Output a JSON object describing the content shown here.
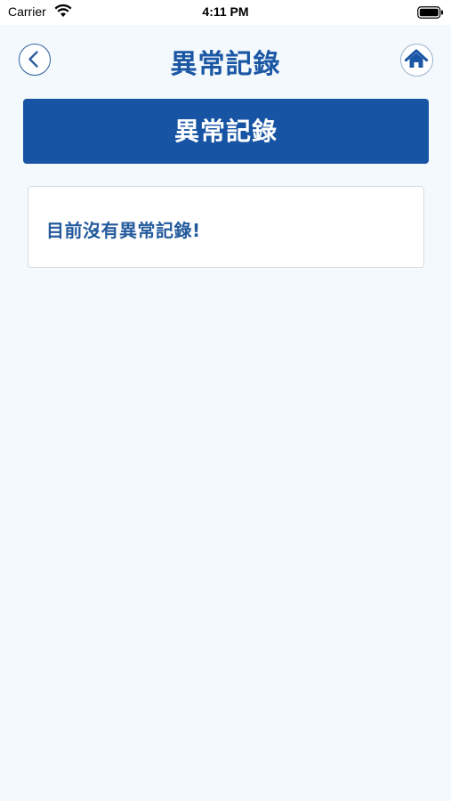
{
  "status_bar": {
    "carrier": "Carrier",
    "time": "4:11 PM",
    "wifi_icon": "wifi-icon",
    "battery_icon": "battery-icon"
  },
  "nav": {
    "title": "異常記錄",
    "back_icon": "chevron-left-icon",
    "home_icon": "home-icon"
  },
  "section": {
    "banner_label": "異常記錄"
  },
  "content": {
    "empty_message": "目前沒有異常記錄!"
  },
  "colors": {
    "primary": "#1854a4",
    "title_text": "#1b57a4",
    "message_text": "#235a9c",
    "background": "#f3f9fc",
    "card_border": "#d6dde3"
  }
}
